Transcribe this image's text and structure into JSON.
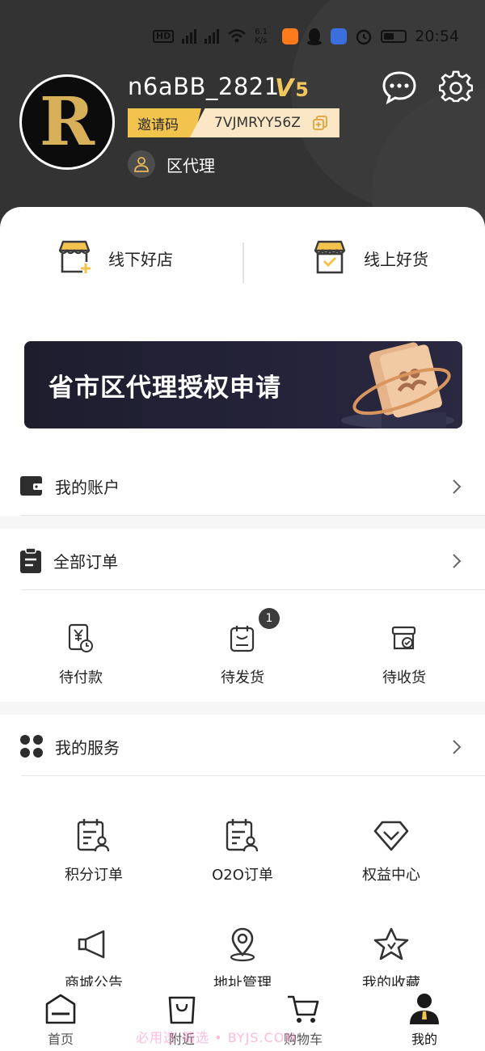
{
  "status_bar": {
    "indicators": [
      "HD",
      "4G",
      "2G"
    ],
    "speed": "6.1 K/s",
    "time": "20:54"
  },
  "profile": {
    "avatar_letter": "R",
    "username": "n6aBB_2821",
    "vip_mark": "V",
    "vip_level": "5",
    "invite_label": "邀请码",
    "invite_code": "7VJMRYY56Z",
    "role": "区代理"
  },
  "colors": {
    "header_bg": "#333333",
    "gold": "#f2c34d",
    "invite_code_bg": "#fbe6c6"
  },
  "shortcuts": [
    {
      "label": "线下好店",
      "icon": "store-add-icon"
    },
    {
      "label": "线上好货",
      "icon": "store-check-icon"
    }
  ],
  "banner": {
    "title": "省市区代理授权申请"
  },
  "account": {
    "title": "我的账户"
  },
  "orders": {
    "title": "全部订单",
    "items": [
      {
        "label": "待付款",
        "icon": "payment-pending-icon"
      },
      {
        "label": "待发货",
        "icon": "ship-pending-icon",
        "badge": "1"
      },
      {
        "label": "待收货",
        "icon": "receive-pending-icon"
      }
    ]
  },
  "services": {
    "title": "我的服务",
    "items": [
      {
        "label": "积分订单",
        "icon": "points-order-icon"
      },
      {
        "label": "O2O订单",
        "icon": "o2o-order-icon"
      },
      {
        "label": "权益中心",
        "icon": "diamond-icon"
      },
      {
        "label": "商城公告",
        "icon": "megaphone-icon"
      },
      {
        "label": "地址管理",
        "icon": "location-pin-icon"
      },
      {
        "label": "我的收藏",
        "icon": "star-icon"
      }
    ]
  },
  "tabbar": [
    {
      "label": "首页",
      "icon": "home-icon"
    },
    {
      "label": "附近",
      "icon": "shopping-bag-icon"
    },
    {
      "label": "购物车",
      "icon": "cart-icon"
    },
    {
      "label": "我的",
      "icon": "user-icon",
      "active": true
    }
  ],
  "watermark": "必用选 精选 • BYJS.COM"
}
